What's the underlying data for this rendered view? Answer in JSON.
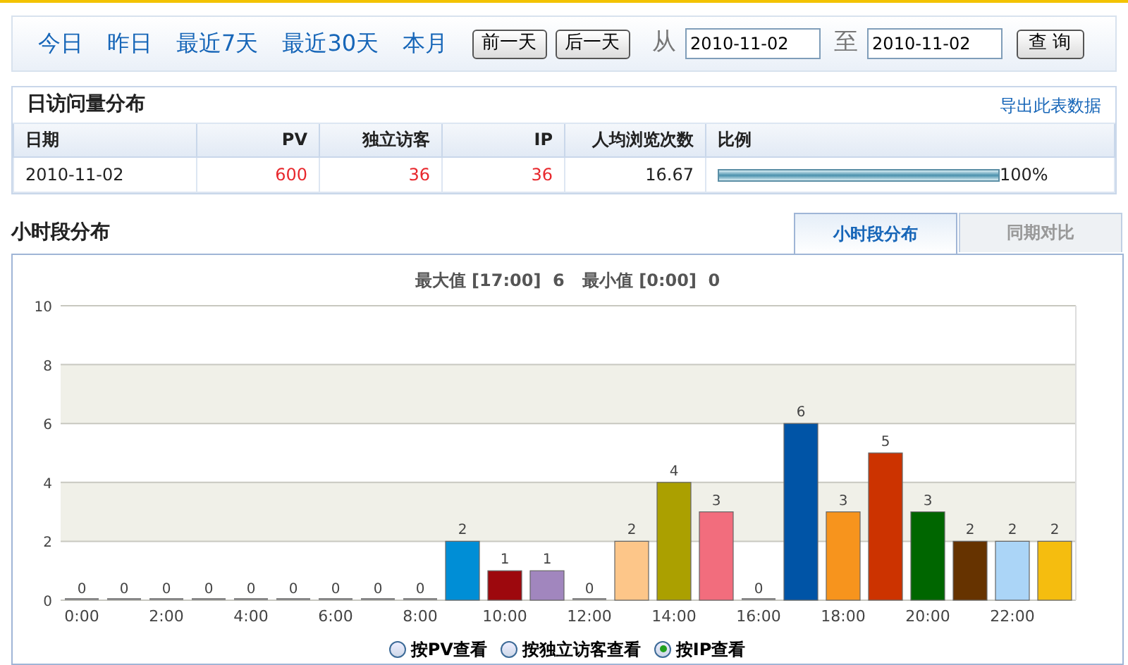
{
  "nav": {
    "quick_links": [
      "今日",
      "昨日",
      "最近7天",
      "最近30天",
      "本月"
    ],
    "prev_button": "前一天",
    "next_button": "后一天",
    "from_label": "从",
    "from_date": "2010-11-02",
    "to_label": "至",
    "to_date": "2010-11-02",
    "query_button": "查 询"
  },
  "daily": {
    "title": "日访问量分布",
    "export_link": "导出此表数据",
    "columns": [
      "日期",
      "PV",
      "独立访客",
      "IP",
      "人均浏览次数",
      "比例"
    ],
    "rows": [
      {
        "date": "2010-11-02",
        "pv": "600",
        "visitors": "36",
        "ip": "36",
        "avg_views": "16.67",
        "level": 1,
        "ratio": "100%"
      }
    ]
  },
  "hourly": {
    "title": "小时段分布",
    "tabs": [
      {
        "label": "小时段分布",
        "selected": true
      },
      {
        "label": "同期对比",
        "selected": false
      }
    ],
    "summary": "最大值 [17:00]  6   最小值 [0:00]  0",
    "chart_data": {
      "type": "bar",
      "x": [
        0,
        1,
        2,
        3,
        4,
        5,
        6,
        7,
        8,
        9,
        10,
        11,
        12,
        13,
        14,
        15,
        16,
        17,
        18,
        19,
        20,
        21,
        22,
        23
      ],
      "series": [
        {
          "color": "#888888",
          "values": [
            0,
            null,
            null,
            null,
            null,
            null,
            null,
            null,
            null,
            null,
            null,
            null,
            null,
            null,
            null,
            null,
            null,
            null,
            null,
            null,
            null,
            null,
            null,
            null
          ]
        },
        {
          "color": "#888888",
          "values": [
            null,
            0,
            null,
            null,
            null,
            null,
            null,
            null,
            null,
            null,
            null,
            null,
            null,
            null,
            null,
            null,
            null,
            null,
            null,
            null,
            null,
            null,
            null,
            null
          ]
        },
        {
          "color": "#888888",
          "values": [
            null,
            null,
            0,
            null,
            null,
            null,
            null,
            null,
            null,
            null,
            null,
            null,
            null,
            null,
            null,
            null,
            null,
            null,
            null,
            null,
            null,
            null,
            null,
            null
          ]
        },
        {
          "color": "#888888",
          "values": [
            null,
            null,
            null,
            0,
            null,
            null,
            null,
            null,
            null,
            null,
            null,
            null,
            null,
            null,
            null,
            null,
            null,
            null,
            null,
            null,
            null,
            null,
            null,
            null
          ]
        },
        {
          "color": "#888888",
          "values": [
            null,
            null,
            null,
            null,
            0,
            null,
            null,
            null,
            null,
            null,
            null,
            null,
            null,
            null,
            null,
            null,
            null,
            null,
            null,
            null,
            null,
            null,
            null,
            null
          ]
        },
        {
          "color": "#888888",
          "values": [
            null,
            null,
            null,
            null,
            null,
            0,
            null,
            null,
            null,
            null,
            null,
            null,
            null,
            null,
            null,
            null,
            null,
            null,
            null,
            null,
            null,
            null,
            null,
            null
          ]
        },
        {
          "color": "#888888",
          "values": [
            null,
            null,
            null,
            null,
            null,
            null,
            0,
            null,
            null,
            null,
            null,
            null,
            null,
            null,
            null,
            null,
            null,
            null,
            null,
            null,
            null,
            null,
            null,
            null
          ]
        },
        {
          "color": "#888888",
          "values": [
            null,
            null,
            null,
            null,
            null,
            null,
            null,
            0,
            null,
            null,
            null,
            null,
            null,
            null,
            null,
            null,
            null,
            null,
            null,
            null,
            null,
            null,
            null,
            null
          ]
        },
        {
          "color": "#888888",
          "values": [
            null,
            null,
            null,
            null,
            null,
            null,
            null,
            null,
            0,
            null,
            null,
            null,
            null,
            null,
            null,
            null,
            null,
            null,
            null,
            null,
            null,
            null,
            null,
            null
          ]
        },
        {
          "color": "#008ed6",
          "values": [
            null,
            null,
            null,
            null,
            null,
            null,
            null,
            null,
            null,
            2,
            null,
            null,
            null,
            null,
            null,
            null,
            null,
            null,
            null,
            null,
            null,
            null,
            null,
            null
          ]
        },
        {
          "color": "#9d080d",
          "values": [
            null,
            null,
            null,
            null,
            null,
            null,
            null,
            null,
            null,
            null,
            1,
            null,
            null,
            null,
            null,
            null,
            null,
            null,
            null,
            null,
            null,
            null,
            null,
            null
          ]
        },
        {
          "color": "#a186be",
          "values": [
            null,
            null,
            null,
            null,
            null,
            null,
            null,
            null,
            null,
            null,
            null,
            1,
            null,
            null,
            null,
            null,
            null,
            null,
            null,
            null,
            null,
            null,
            null,
            null
          ]
        },
        {
          "color": "#888888",
          "values": [
            null,
            null,
            null,
            null,
            null,
            null,
            null,
            null,
            null,
            null,
            null,
            null,
            0,
            null,
            null,
            null,
            null,
            null,
            null,
            null,
            null,
            null,
            null,
            null
          ]
        },
        {
          "color": "#fdc689",
          "values": [
            null,
            null,
            null,
            null,
            null,
            null,
            null,
            null,
            null,
            null,
            null,
            null,
            null,
            2,
            null,
            null,
            null,
            null,
            null,
            null,
            null,
            null,
            null,
            null
          ]
        },
        {
          "color": "#aba000",
          "values": [
            null,
            null,
            null,
            null,
            null,
            null,
            null,
            null,
            null,
            null,
            null,
            null,
            null,
            null,
            4,
            null,
            null,
            null,
            null,
            null,
            null,
            null,
            null,
            null
          ]
        },
        {
          "color": "#f26d7d",
          "values": [
            null,
            null,
            null,
            null,
            null,
            null,
            null,
            null,
            null,
            null,
            null,
            null,
            null,
            null,
            null,
            3,
            null,
            null,
            null,
            null,
            null,
            null,
            null,
            null
          ]
        },
        {
          "color": "#888888",
          "values": [
            null,
            null,
            null,
            null,
            null,
            null,
            null,
            null,
            null,
            null,
            null,
            null,
            null,
            null,
            null,
            null,
            0,
            null,
            null,
            null,
            null,
            null,
            null,
            null
          ]
        },
        {
          "color": "#0054a6",
          "values": [
            null,
            null,
            null,
            null,
            null,
            null,
            null,
            null,
            null,
            null,
            null,
            null,
            null,
            null,
            null,
            null,
            null,
            6,
            null,
            null,
            null,
            null,
            null,
            null
          ]
        },
        {
          "color": "#f7941d",
          "values": [
            null,
            null,
            null,
            null,
            null,
            null,
            null,
            null,
            null,
            null,
            null,
            null,
            null,
            null,
            null,
            null,
            null,
            null,
            3,
            null,
            null,
            null,
            null,
            null
          ]
        },
        {
          "color": "#cc3300",
          "values": [
            null,
            null,
            null,
            null,
            null,
            null,
            null,
            null,
            null,
            null,
            null,
            null,
            null,
            null,
            null,
            null,
            null,
            null,
            null,
            5,
            null,
            null,
            null,
            null
          ]
        },
        {
          "color": "#006600",
          "values": [
            null,
            null,
            null,
            null,
            null,
            null,
            null,
            null,
            null,
            null,
            null,
            null,
            null,
            null,
            null,
            null,
            null,
            null,
            null,
            null,
            3,
            null,
            null,
            null
          ]
        },
        {
          "color": "#663300",
          "values": [
            null,
            null,
            null,
            null,
            null,
            null,
            null,
            null,
            null,
            null,
            null,
            null,
            null,
            null,
            null,
            null,
            null,
            null,
            null,
            null,
            null,
            2,
            null,
            null
          ]
        },
        {
          "color": "#abd5f7",
          "values": [
            null,
            null,
            null,
            null,
            null,
            null,
            null,
            null,
            null,
            null,
            null,
            null,
            null,
            null,
            null,
            null,
            null,
            null,
            null,
            null,
            null,
            null,
            2,
            null
          ]
        },
        {
          "color": "#f5bd0f",
          "values": [
            null,
            null,
            null,
            null,
            null,
            null,
            null,
            null,
            null,
            null,
            null,
            null,
            null,
            null,
            null,
            null,
            null,
            null,
            null,
            null,
            null,
            null,
            null,
            2
          ]
        }
      ],
      "grid": true,
      "xlim": [
        -0.5,
        23.5
      ],
      "ylim": [
        0,
        10
      ],
      "yticks": [
        0,
        2,
        4,
        6,
        8,
        10
      ],
      "xticks": [
        {
          "value": 0,
          "label": "0:00"
        },
        {
          "value": 2,
          "label": "2:00"
        },
        {
          "value": 4,
          "label": "4:00"
        },
        {
          "value": 6,
          "label": "6:00"
        },
        {
          "value": 8,
          "label": "8:00"
        },
        {
          "value": 10,
          "label": "10:00"
        },
        {
          "value": 12,
          "label": "12:00"
        },
        {
          "value": 14,
          "label": "14:00"
        },
        {
          "value": 16,
          "label": "16:00"
        },
        {
          "value": 18,
          "label": "18:00"
        },
        {
          "value": 20,
          "label": "20:00"
        },
        {
          "value": 22,
          "label": "22:00"
        }
      ],
      "data_labels": true
    },
    "view_options": [
      {
        "label": "按PV查看",
        "selected": false
      },
      {
        "label": "按独立访客查看",
        "selected": false
      },
      {
        "label": "按IP查看",
        "selected": true
      }
    ]
  }
}
